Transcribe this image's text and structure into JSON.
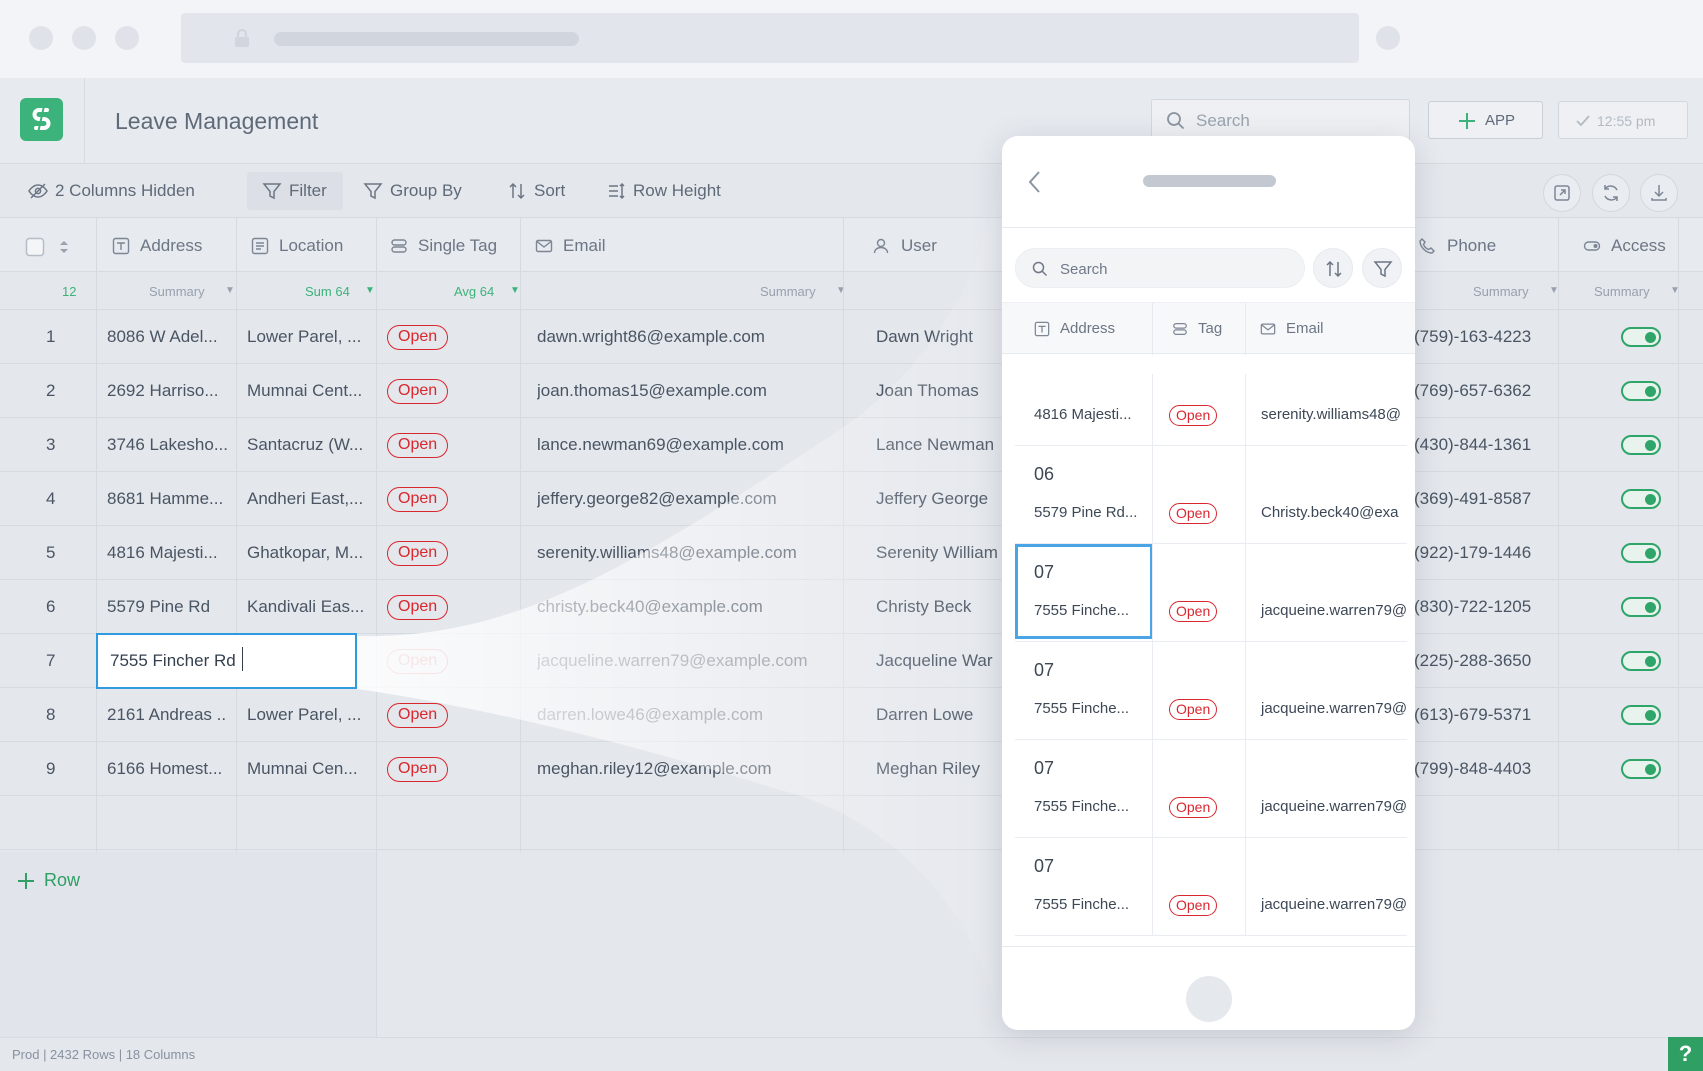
{
  "app": {
    "title": "Leave Management"
  },
  "header": {
    "search_placeholder": "Search",
    "add_app_label": "APP",
    "time_label": "12:55 pm"
  },
  "toolbar": {
    "hidden_columns": "2 Columns Hidden",
    "filter": "Filter",
    "group_by": "Group By",
    "sort": "Sort",
    "row_height": "Row Height"
  },
  "columns": {
    "address": "Address",
    "location": "Location",
    "single_tag": "Single Tag",
    "email": "Email",
    "user": "User",
    "phone": "Phone",
    "access": "Access"
  },
  "summary": {
    "count": "12",
    "address": "Summary",
    "location": "Sum 64",
    "single_tag": "Avg 64",
    "email": "Summary",
    "phone": "Summary",
    "access": "Summary"
  },
  "rows": [
    {
      "n": "1",
      "address": "8086 W Adel...",
      "location": "Lower Parel, ...",
      "tag": "Open",
      "email": "dawn.wright86@example.com",
      "user": "Dawn Wright",
      "phone": "(759)-163-4223"
    },
    {
      "n": "2",
      "address": "2692 Harriso...",
      "location": "Mumnai Cent...",
      "tag": "Open",
      "email": "joan.thomas15@example.com",
      "user": "Joan Thomas",
      "phone": "(769)-657-6362"
    },
    {
      "n": "3",
      "address": "3746 Lakesho...",
      "location": "Santacruz (W...",
      "tag": "Open",
      "email": "lance.newman69@example.com",
      "user": "Lance Newman",
      "phone": "(430)-844-1361"
    },
    {
      "n": "4",
      "address": "8681 Hamme...",
      "location": "Andheri East,...",
      "tag": "Open",
      "email": "jeffery.george82@example.com",
      "user": "Jeffery George",
      "phone": "(369)-491-8587"
    },
    {
      "n": "5",
      "address": "4816 Majesti...",
      "location": "Ghatkopar, M...",
      "tag": "Open",
      "email": "serenity.williams48@example.com",
      "user": "Serenity William",
      "phone": "(922)-179-1446"
    },
    {
      "n": "6",
      "address": "5579 Pine Rd",
      "location": "Kandivali Eas...",
      "tag": "Open",
      "email": "christy.beck40@example.com",
      "user": "Christy Beck",
      "phone": "(830)-722-1205"
    },
    {
      "n": "7",
      "address": "7555 Fincher Rd",
      "location": "",
      "tag": "Open",
      "email": "jacqueline.warren79@example.com",
      "user": "Jacqueline War",
      "phone": "(225)-288-3650"
    },
    {
      "n": "8",
      "address": "2161 Andreas ...",
      "location": "Lower Parel, ...",
      "tag": "Open",
      "email": "darren.lowe46@example.com",
      "user": "Darren Lowe",
      "phone": "(613)-679-5371"
    },
    {
      "n": "9",
      "address": "6166 Homest...",
      "location": "Mumnai Cen...",
      "tag": "Open",
      "email": "meghan.riley12@example.com",
      "user": "Meghan Riley",
      "phone": "(799)-848-4403"
    }
  ],
  "editing": {
    "value": "7555 Fincher Rd"
  },
  "add_row": "Row",
  "footer": {
    "status": "Prod  |  2432 Rows  |  18 Columns"
  },
  "help": "?",
  "phone": {
    "search_placeholder": "Search",
    "columns": {
      "address": "Address",
      "tag": "Tag",
      "email": "Email"
    },
    "rows": [
      {
        "num": "",
        "address": "4816 Majesti...",
        "tag": "Open",
        "email": "serenity.williams48@"
      },
      {
        "num": "06",
        "address": "5579 Pine Rd...",
        "tag": "Open",
        "email": "Christy.beck40@exa"
      },
      {
        "num": "07",
        "address": "7555 Finche...",
        "tag": "Open",
        "email": "jacqueine.warren79@"
      },
      {
        "num": "07",
        "address": "7555 Finche...",
        "tag": "Open",
        "email": "jacqueine.warren79@"
      },
      {
        "num": "07",
        "address": "7555 Finche...",
        "tag": "Open",
        "email": "jacqueine.warren79@"
      },
      {
        "num": "07",
        "address": "7555 Finche...",
        "tag": "Open",
        "email": "jacqueine.warren79@"
      }
    ]
  }
}
